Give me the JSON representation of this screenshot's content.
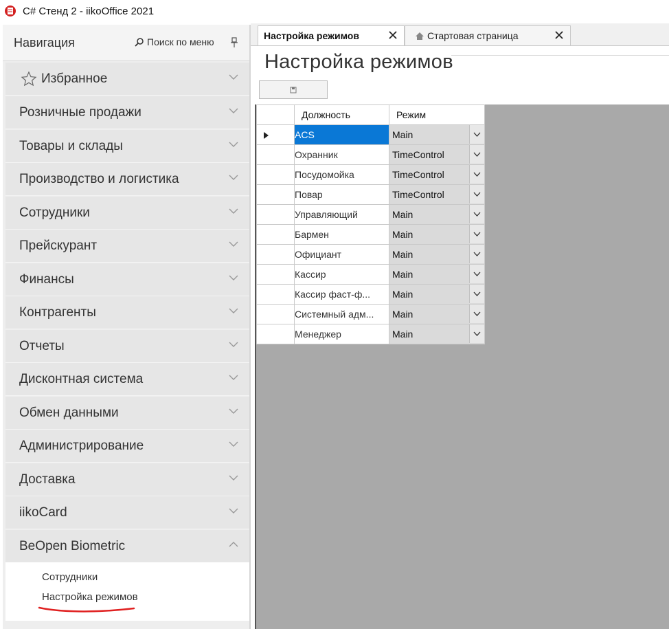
{
  "window": {
    "title": "C# Стенд 2 - iikoOffice 2021"
  },
  "nav": {
    "title": "Навигация",
    "search_label": "Поиск по меню",
    "groups": [
      {
        "label": "Избранное"
      },
      {
        "label": "Розничные продажи"
      },
      {
        "label": "Товары и склады"
      },
      {
        "label": "Производство и логистика"
      },
      {
        "label": "Сотрудники"
      },
      {
        "label": "Прейскурант"
      },
      {
        "label": "Финансы"
      },
      {
        "label": "Контрагенты"
      },
      {
        "label": "Отчеты"
      },
      {
        "label": "Дисконтная система"
      },
      {
        "label": "Обмен данными"
      },
      {
        "label": "Администрирование"
      },
      {
        "label": "Доставка"
      },
      {
        "label": "iikoCard"
      },
      {
        "label": "BeOpen Biometric"
      }
    ],
    "expanded_group": "BeOpen Biometric",
    "sub_items": [
      {
        "label": "Сотрудники"
      },
      {
        "label": "Настройка режимов"
      }
    ]
  },
  "tabs": [
    {
      "label": "Настройка режимов",
      "active": true
    },
    {
      "label": "Стартовая страница",
      "active": false
    }
  ],
  "page": {
    "title": "Настройка режимов"
  },
  "grid": {
    "columns": [
      "Должность",
      "Режим"
    ],
    "rows": [
      {
        "position": "ACS",
        "mode": "Main",
        "selected": true
      },
      {
        "position": "Охранник",
        "mode": "TimeControl"
      },
      {
        "position": "Посудомойка",
        "mode": "TimeControl"
      },
      {
        "position": "Повар",
        "mode": "TimeControl"
      },
      {
        "position": "Управляющий",
        "mode": "Main"
      },
      {
        "position": "Бармен",
        "mode": "Main"
      },
      {
        "position": "Официант",
        "mode": "Main"
      },
      {
        "position": "Кассир",
        "mode": "Main"
      },
      {
        "position": "Кассир фаст-ф...",
        "mode": "Main"
      },
      {
        "position": "Системный адм...",
        "mode": "Main"
      },
      {
        "position": "Менеджер",
        "mode": "Main"
      }
    ]
  },
  "colors": {
    "selection": "#0a78d6",
    "annotation_underline": "#e02020",
    "nav_background": "#e6e6e6"
  }
}
